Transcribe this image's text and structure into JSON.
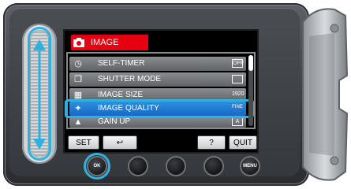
{
  "screen": {
    "title": "IMAGE",
    "title_color": "#e60012",
    "highlight_color": "#2fb0dd"
  },
  "menu": {
    "items": [
      {
        "icon": "self-timer-icon",
        "label": "SELF-TIMER",
        "value": "OFF"
      },
      {
        "icon": "shutter-mode-icon",
        "label": "SHUTTER MODE",
        "value": ""
      },
      {
        "icon": "image-size-icon",
        "label": "IMAGE SIZE",
        "value": "1920"
      },
      {
        "icon": "image-quality-icon",
        "label": "IMAGE QUALITY",
        "value": "FINE"
      },
      {
        "icon": "gain-up-icon",
        "label": "GAIN UP",
        "value": "A"
      }
    ],
    "selected_index": 3
  },
  "buttons": {
    "set": "SET",
    "back": "↩",
    "help": "?",
    "quit": "QUIT"
  },
  "hardware": {
    "ok": "OK",
    "menu": "MENU"
  }
}
